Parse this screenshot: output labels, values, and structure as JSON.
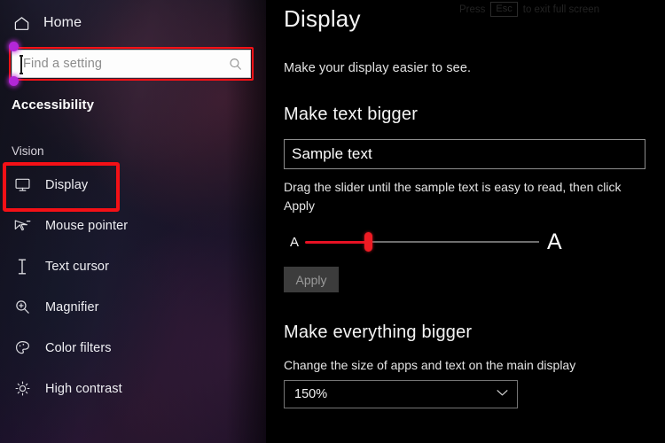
{
  "sidebar": {
    "home": {
      "label": "Home",
      "icon": "home-icon"
    },
    "search": {
      "value": "",
      "placeholder": "Find a setting",
      "icon": "search-icon"
    },
    "section_title": "Accessibility",
    "group_label": "Vision",
    "items": [
      {
        "label": "Display",
        "icon": "monitor-icon",
        "highlighted": true
      },
      {
        "label": "Mouse pointer",
        "icon": "mouse-pointer-icon",
        "highlighted": false
      },
      {
        "label": "Text cursor",
        "icon": "text-cursor-icon",
        "highlighted": false
      },
      {
        "label": "Magnifier",
        "icon": "magnifier-icon",
        "highlighted": false
      },
      {
        "label": "Color filters",
        "icon": "palette-icon",
        "highlighted": false
      },
      {
        "label": "High contrast",
        "icon": "brightness-icon",
        "highlighted": false
      }
    ]
  },
  "main": {
    "esc_hint": {
      "prefix": "Press",
      "key": "Esc",
      "suffix": "to exit full screen"
    },
    "title": "Display",
    "subtitle": "Make your display easier to see.",
    "text_section": {
      "heading": "Make text bigger",
      "sample_text": "Sample text",
      "hint": "Drag the slider until the sample text is easy to read, then click Apply",
      "slider": {
        "min_label": "A",
        "max_label": "A",
        "value_percent": 27,
        "fill_color": "#e81123",
        "thumb_color": "#ee1b23"
      },
      "apply_label": "Apply"
    },
    "scale_section": {
      "heading": "Make everything bigger",
      "description": "Change the size of apps and text on the main display",
      "dropdown_value": "150%",
      "chevron": "⌄"
    }
  },
  "accents": {
    "highlight_red": "#f41016",
    "handle_purple": "#b327d8"
  }
}
